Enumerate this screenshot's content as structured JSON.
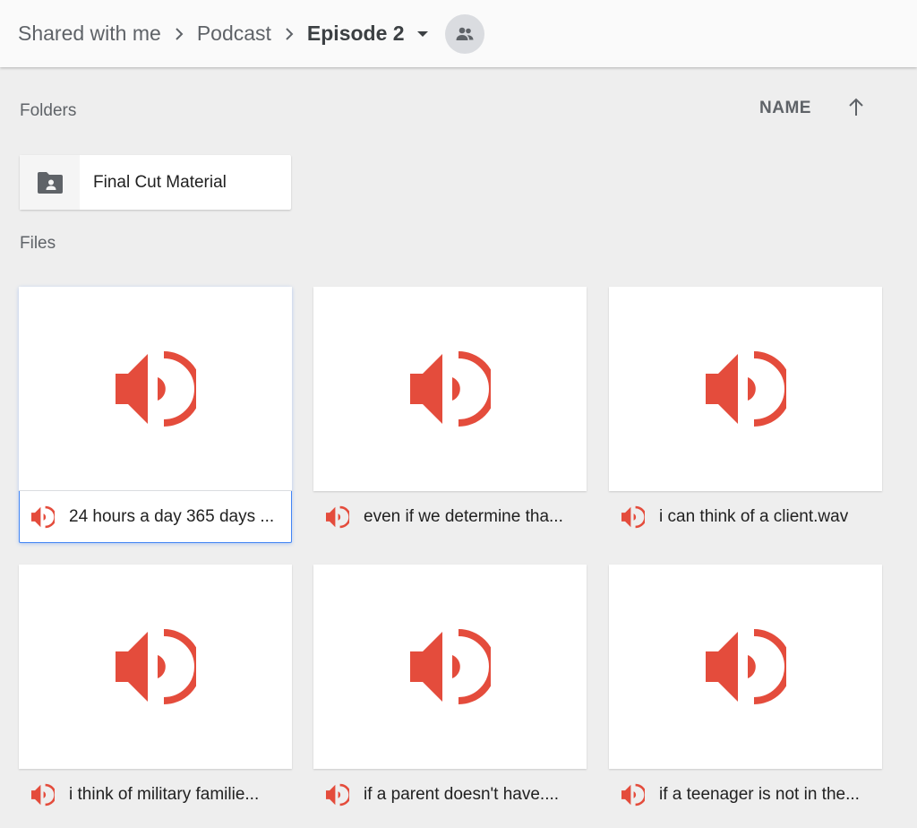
{
  "breadcrumb": {
    "items": [
      "Shared with me",
      "Podcast"
    ],
    "current": "Episode 2"
  },
  "sections": {
    "folders_label": "Folders",
    "files_label": "Files"
  },
  "sort": {
    "label": "NAME",
    "direction_icon": "arrow-up-icon"
  },
  "folders": [
    {
      "name": "Final Cut Material",
      "icon": "shared-folder-icon"
    }
  ],
  "files": [
    {
      "name": "24 hours a day 365 days ...",
      "icon": "audio-icon",
      "selected": true
    },
    {
      "name": "even if we determine tha...",
      "icon": "audio-icon",
      "selected": false
    },
    {
      "name": "i can think of a client.wav",
      "icon": "audio-icon",
      "selected": false
    },
    {
      "name": "i think of military familie...",
      "icon": "audio-icon",
      "selected": false
    },
    {
      "name": "if a parent doesn't have....",
      "icon": "audio-icon",
      "selected": false
    },
    {
      "name": "if a teenager is not in the...",
      "icon": "audio-icon",
      "selected": false
    }
  ],
  "colors": {
    "audio_red": "#e44c3c",
    "selection_blue": "#4285f4"
  }
}
